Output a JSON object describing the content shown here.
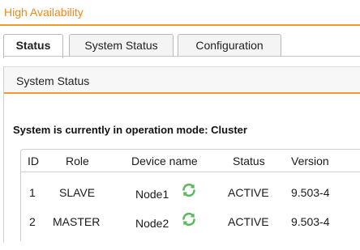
{
  "app": {
    "title": "High Availability"
  },
  "tabs": [
    {
      "label": "Status",
      "active": true
    },
    {
      "label": "System Status",
      "active": false
    },
    {
      "label": "Configuration",
      "active": false
    }
  ],
  "panel": {
    "header": "System Status",
    "mode_text": "System is currently in operation mode: Cluster"
  },
  "table": {
    "columns": [
      "ID",
      "Role",
      "Device name",
      "Status",
      "Version"
    ],
    "rows": [
      {
        "id": "1",
        "role": "SLAVE",
        "device": "Node1",
        "status": "ACTIVE",
        "version": "9.503-4",
        "icon": "sync-icon"
      },
      {
        "id": "2",
        "role": "MASTER",
        "device": "Node2",
        "status": "ACTIVE",
        "version": "9.503-4",
        "icon": "sync-icon"
      }
    ]
  },
  "colors": {
    "accent": "#f39a2b",
    "title": "#ef8a1e",
    "icon": "#5cb85c"
  }
}
